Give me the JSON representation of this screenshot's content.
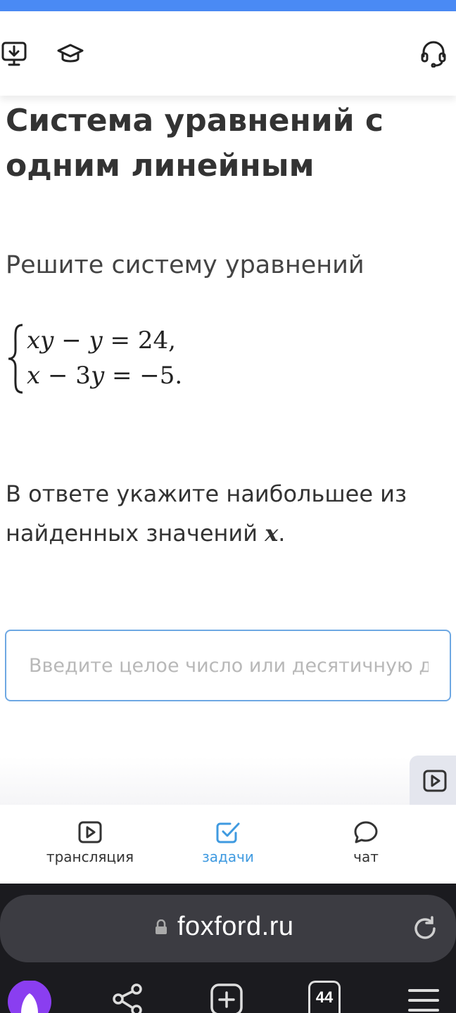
{
  "task": {
    "title": "Система уравнений с одним линейным",
    "prompt": "Решите систему уравнений",
    "answer_prefix": "В ответе укажите наибольшее из найденных значений ",
    "answer_var": "x",
    "answer_suffix": "."
  },
  "answer_input": {
    "value": "",
    "placeholder": "Введите целое число или десятичную дробь"
  },
  "tabs": [
    {
      "label": "трансляция",
      "icon": "play-square-icon"
    },
    {
      "label": "задачи",
      "icon": "checkbox-icon",
      "active": true
    },
    {
      "label": "чат",
      "icon": "chat-bubble-icon"
    }
  ],
  "browser": {
    "url": "foxford.ru",
    "tabs_count": "44"
  },
  "colors": {
    "accent": "#4a8af4",
    "active_tab": "#3f9ae0",
    "input_border": "#6ea8e3",
    "browser_bg": "#1b1b1f",
    "urlbar_bg": "#3c3c42",
    "alice": "#8a3ef0"
  }
}
